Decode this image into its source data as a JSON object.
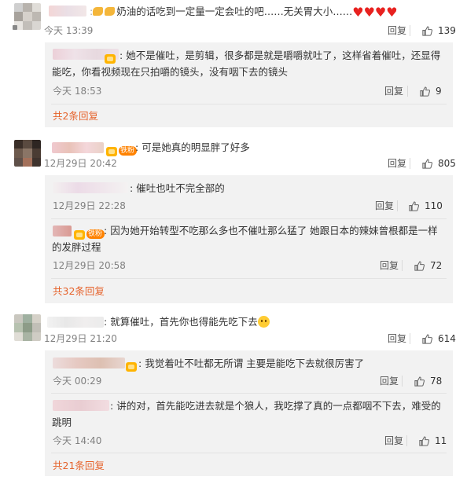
{
  "theme": {
    "orange": "#e6632c",
    "heart_red": "#e8211f",
    "badge_orange": "#ff8200"
  },
  "comments": [
    {
      "text_a": "奶油的话吃到一定量一定会吐的吧……无关胃大小……",
      "time": "今天 13:39",
      "reply_label": "回复",
      "likes": "139",
      "subs": [
        {
          "text": "她不是催吐，是剪辑，很多都是就是嚼嚼就吐了，这样省着催吐，还显得能吃，你看视频现在只拍嚼的镜头，没有咽下去的镜头",
          "time": "今天 18:53",
          "reply_label": "回复",
          "likes": "9"
        }
      ],
      "more": "共2条回复"
    },
    {
      "badge": "铁粉",
      "text_a": "可是她真的明显胖了好多",
      "time": "12月29日 20:42",
      "reply_label": "回复",
      "likes": "805",
      "subs": [
        {
          "text": "催吐也吐不完全部的",
          "time": "12月29日 22:28",
          "reply_label": "回复",
          "likes": "110"
        },
        {
          "badge": "铁粉",
          "text": "因为她开始转型不吃那么多也不催吐那么猛了 她跟日本的辣妹曾根都是一样的发胖过程",
          "time": "12月29日 20:58",
          "reply_label": "回复",
          "likes": "72"
        }
      ],
      "more": "共32条回复"
    },
    {
      "text_a": "就算催吐，首先你也得能先吃下去",
      "time": "12月29日 21:20",
      "reply_label": "回复",
      "likes": "614",
      "subs": [
        {
          "text": "我觉着吐不吐都无所谓 主要是能吃下去就很厉害了",
          "time": "今天 00:29",
          "reply_label": "回复",
          "likes": "78"
        },
        {
          "text": "讲的对，首先能吃进去就是个狼人，我吃撑了真的一点都咽不下去，难受的跳明",
          "time": "今天 14:40",
          "reply_label": "回复",
          "likes": "11"
        }
      ],
      "more": "共21条回复"
    }
  ]
}
